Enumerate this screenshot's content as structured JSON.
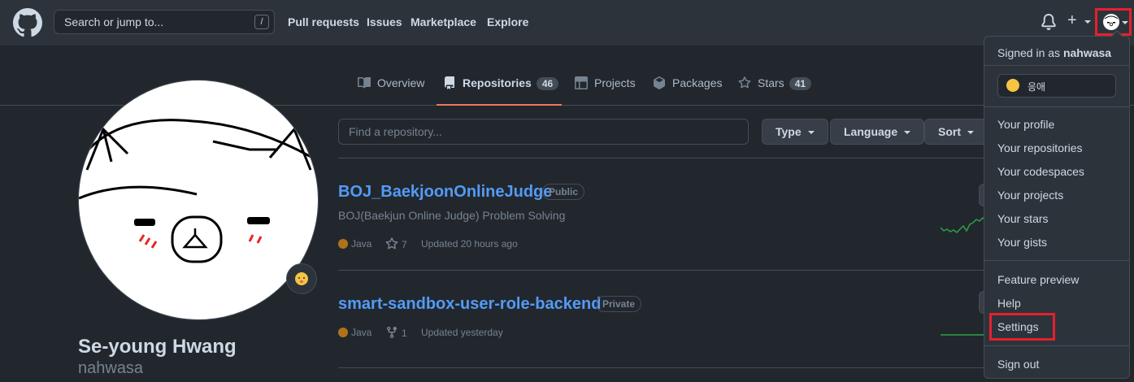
{
  "header": {
    "search_placeholder": "Search or jump to...",
    "search_shortcut": "/",
    "nav": [
      "Pull requests",
      "Issues",
      "Marketplace",
      "Explore"
    ],
    "plus_label": "+",
    "icons": [
      "github-logo-icon",
      "bell-icon",
      "plus-icon",
      "avatar"
    ]
  },
  "tabs": [
    {
      "label": "Overview",
      "icon": "book-icon"
    },
    {
      "label": "Repositories",
      "icon": "repo-icon",
      "count": "46",
      "selected": true
    },
    {
      "label": "Projects",
      "icon": "table-icon"
    },
    {
      "label": "Packages",
      "icon": "package-icon"
    },
    {
      "label": "Stars",
      "icon": "star-icon",
      "count": "41"
    }
  ],
  "profile": {
    "name": "Se-young Hwang",
    "login": "nahwasa"
  },
  "repo_filter": {
    "placeholder": "Find a repository...",
    "buttons": [
      "Type",
      "Language",
      "Sort"
    ]
  },
  "repos": [
    {
      "name": "BOJ_BaekjoonOnlineJudge",
      "visibility": "Public",
      "description": "BOJ(Baekjun Online Judge) Problem Solving",
      "language": "Java",
      "stars": "7",
      "updated": "Updated 20 hours ago"
    },
    {
      "name": "smart-sandbox-user-role-backend",
      "visibility": "Private",
      "language": "Java",
      "forks": "1",
      "updated": "Updated yesterday"
    }
  ],
  "dropdown": {
    "signed_in_prefix": "Signed in as",
    "username": "nahwasa",
    "status_text": "응애",
    "group1": [
      "Your profile",
      "Your repositories",
      "Your codespaces",
      "Your projects",
      "Your stars",
      "Your gists"
    ],
    "group2": [
      "Feature preview",
      "Help",
      "Settings"
    ],
    "sign_out": "Sign out"
  },
  "colors": {
    "highlight": "#e5202e",
    "link": "#539bf5",
    "java": "#b07219",
    "tab_underline": "#ec775c"
  }
}
